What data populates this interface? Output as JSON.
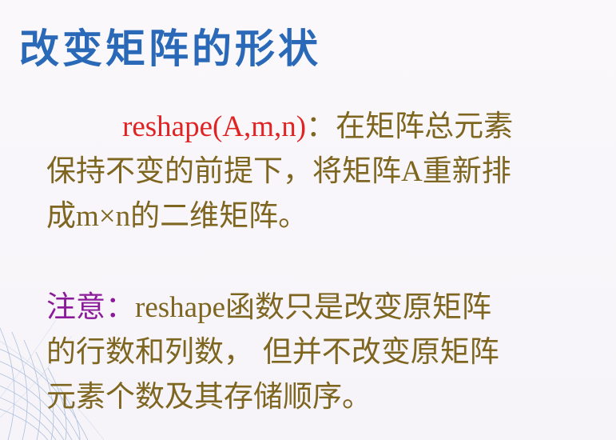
{
  "slide": {
    "title": "改变矩阵的形状",
    "paragraph1": {
      "line1_func": "reshape(A,m,n)",
      "line1_text": "：在矩阵总元素",
      "line2_pre": "保持不变的前提下，将矩阵",
      "line2_a": "A",
      "line2_post": "重新排",
      "line3_pre": "成",
      "line3_mn": "m×n",
      "line3_post": "的二维矩阵。"
    },
    "paragraph2": {
      "note_label": "注意：",
      "line1_func": "reshape",
      "line1_text": "函数只是改变原矩阵",
      "line2": "的行数和列数， 但并不改变原矩阵",
      "line3": "元素个数及其存储顺序。"
    }
  },
  "colors": {
    "title": "#2a69b8",
    "body": "#7e6520",
    "function": "#e02424",
    "note": "#8b1a9a"
  },
  "icons": {
    "decoration": "wire-globe-icon"
  }
}
